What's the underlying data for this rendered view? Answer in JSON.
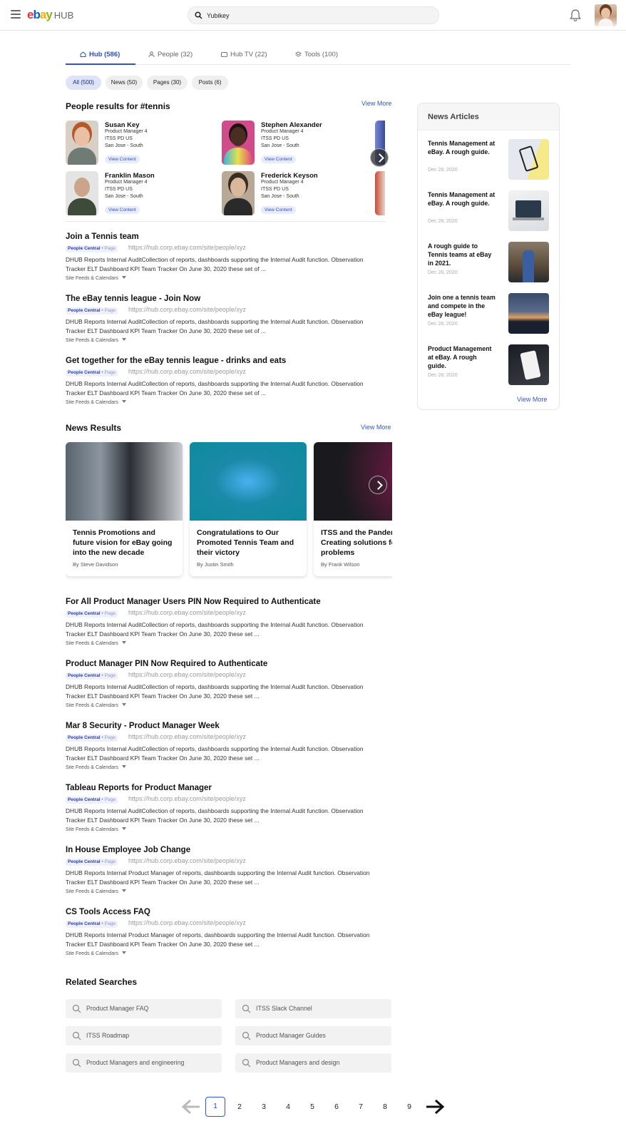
{
  "header": {
    "logo": {
      "e": "e",
      "b": "b",
      "a": "a",
      "y": "y",
      "hub": "HUB"
    },
    "search_value": "Yubikey"
  },
  "tabs": [
    {
      "label": "Hub (586)",
      "icon": "home-icon"
    },
    {
      "label": "People (32)",
      "icon": "person-icon"
    },
    {
      "label": "Hub TV (22)",
      "icon": "tv-icon"
    },
    {
      "label": "Tools (100)",
      "icon": "layers-icon"
    }
  ],
  "filters": [
    "All (500)",
    "News (50)",
    "Pages (30)",
    "Posts (6)"
  ],
  "people_section": {
    "title": "People results for #tennis",
    "view_more": "View More",
    "people": [
      {
        "name": "Susan Key",
        "role": "Product Manager 4",
        "dept": "ITSS PD US",
        "location": "San Jose - South",
        "button": "View Content"
      },
      {
        "name": "Stephen Alexander",
        "role": "Product Manager 4",
        "dept": "ITSS PD US",
        "location": "San Jose - South",
        "button": "View Content"
      },
      {
        "name": "Franklin Mason",
        "role": "Product Manager 4",
        "dept": "ITSS PD US",
        "location": "San Jose - South",
        "button": "View Content"
      },
      {
        "name": "Frederick Keyson",
        "role": "Product Manager 4",
        "dept": "ITSS PD US",
        "location": "San Jose - South",
        "button": "View Content"
      }
    ]
  },
  "results_top": [
    {
      "title": "Join a Tennis team",
      "tag1": "People Central",
      "tag2": "Page",
      "url": "https://hub.corp.ebay.com/site/people/xyz",
      "desc": "DHUB Reports Internal AuditCollection of reports, dashboards supporting the Internal Audit function. Observation Tracker ELT Dashboard KPI Team Tracker On June 30, 2020 these set of ...",
      "more": "Site Feeds & Calendars"
    },
    {
      "title": "The eBay tennis league - Join Now",
      "tag1": "People Central",
      "tag2": "Page",
      "url": "https://hub.corp.ebay.com/site/people/xyz",
      "desc": "DHUB Reports Internal AuditCollection of reports, dashboards supporting the Internal Audit function. Observation Tracker ELT Dashboard KPI Team Tracker On June 30, 2020 these set of ...",
      "more": "Site Feeds & Calendars"
    },
    {
      "title": "Get together for the eBay tennis league - drinks and eats",
      "tag1": "People Central",
      "tag2": "Page",
      "url": "https://hub.corp.ebay.com/site/people/xyz",
      "desc": "DHUB Reports Internal AuditCollection of reports, dashboards supporting the Internal Audit function. Observation Tracker ELT Dashboard KPI Team Tracker On June 30, 2020 these set of ...",
      "more": "Site Feeds & Calendars"
    }
  ],
  "news_section": {
    "title": "News Results",
    "view_more": "View More",
    "cards": [
      {
        "title": "Tennis Promotions and future vision for eBay going into the new decade",
        "by": "By Steve Davidson"
      },
      {
        "title": "Congratulations to Our Promoted Tennis Team and their victory",
        "by": "By Justin Smith"
      },
      {
        "title": "ITSS and the Pandemic: Creating solutions for problems",
        "by": "By Frank Wilson"
      }
    ]
  },
  "results_bottom": [
    {
      "title": "For All Product Manager Users PIN Now Required to Authenticate",
      "tag1": "People Central",
      "tag2": "Page",
      "url": "https://hub.corp.ebay.com/site/people/xyz",
      "desc": "DHUB Reports Internal AuditCollection of reports, dashboards supporting the Internal Audit function. Observation Tracker ELT Dashboard KPI Team Tracker On June 30, 2020 these set ...",
      "more": "Site Feeds & Calendars"
    },
    {
      "title": "Product Manager PIN Now Required to Authenticate",
      "tag1": "People Central",
      "tag2": "Page",
      "url": "https://hub.corp.ebay.com/site/people/xyz",
      "desc": "DHUB Reports Internal AuditCollection of reports, dashboards supporting the Internal Audit function. Observation Tracker ELT Dashboard KPI Team Tracker On June 30, 2020 these set ...",
      "more": "Site Feeds & Calendars"
    },
    {
      "title": "Mar 8 Security -  Product Manager Week",
      "tag1": "People Central",
      "tag2": "Page",
      "url": "https://hub.corp.ebay.com/site/people/xyz",
      "desc": "DHUB Reports Internal AuditCollection of reports, dashboards supporting the Internal Audit function. Observation Tracker ELT Dashboard KPI Team Tracker On June 30, 2020 these set ...",
      "more": "Site Feeds & Calendars"
    },
    {
      "title": "Tableau Reports for Product Manager",
      "tag1": "People Central",
      "tag2": "Page",
      "url": "https://hub.corp.ebay.com/site/people/xyz",
      "desc": "DHUB Reports Internal AuditCollection of reports, dashboards supporting the Internal Audit function. Observation Tracker ELT Dashboard KPI Team Tracker On June 30, 2020 these set ...",
      "more": "Site Feeds & Calendars"
    },
    {
      "title": "In House Employee Job Change",
      "tag1": "People Central",
      "tag2": "Page",
      "url": "https://hub.corp.ebay.com/site/people/xyz",
      "desc": "DHUB Reports Internal Product Manager of reports, dashboards supporting the Internal Audit function. Observation Tracker ELT Dashboard KPI Team Tracker On June 30, 2020 these set ...",
      "more": "Site Feeds & Calendars"
    },
    {
      "title": "CS Tools Access FAQ",
      "tag1": "People Central",
      "tag2": "Page",
      "url": "https://hub.corp.ebay.com/site/people/xyz",
      "desc": "DHUB Reports Internal Product Manager of reports, dashboards supporting the Internal Audit function. Observation Tracker ELT Dashboard KPI Team Tracker On June 30, 2020 these set ...",
      "more": "Site Feeds & Calendars"
    }
  ],
  "news_articles": {
    "title": "News Articles",
    "view_more": "View More",
    "items": [
      {
        "title": "Tennis Management at eBay. A rough guide.",
        "date": "Dec 28, 2020"
      },
      {
        "title": "Tennis Management at eBay. A rough guide.",
        "date": "Dec 28, 2020"
      },
      {
        "title": "A rough guide to Tennis teams at eBay in 2021.",
        "date": "Dec 28, 2020"
      },
      {
        "title": "Join one a tennis team and compete in the eBay league!",
        "date": "Dec 28, 2020"
      },
      {
        "title": "Product Management at eBay. A rough guide.",
        "date": "Dec 28, 2020"
      }
    ]
  },
  "related": {
    "title": "Related Searches",
    "items": [
      "Product Manager FAQ",
      "ITSS Slack Channel",
      "ITSS Roadmap",
      "Product Manager Guides",
      "Product Managers and engineering",
      "Product Managers and design"
    ]
  },
  "pagination": {
    "pages": [
      "1",
      "2",
      "3",
      "4",
      "5",
      "6",
      "7",
      "8",
      "9"
    ],
    "current": "1"
  },
  "colors": {
    "accent": "#3352c9",
    "tag_bg": "#eef1fb",
    "chip_active": "#dfe3f6"
  }
}
